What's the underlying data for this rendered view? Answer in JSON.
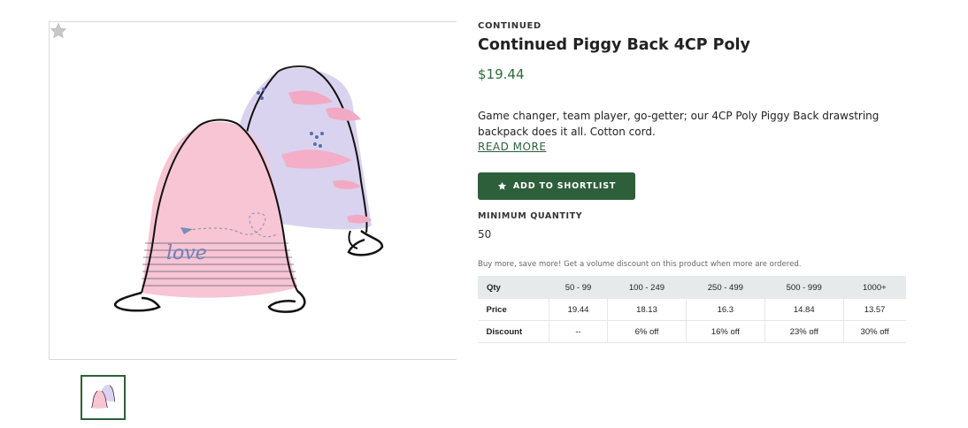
{
  "product": {
    "brand": "CONTINUED",
    "title": "Continued Piggy Back 4CP Poly",
    "price": "$19.44",
    "description": "Game changer, team player, go-getter; our 4CP Poly Piggy Back drawstring backpack does it all. Cotton cord.",
    "read_more_label": "READ MORE",
    "shortlist_label": "ADD TO SHORTLIST",
    "min_qty_label": "MINIMUM QUANTITY",
    "min_qty_value": "50",
    "volume_note": "Buy more, save more! Get a volume discount on this product when more are ordered.",
    "image_text": "love"
  },
  "pricing_table": {
    "headers": [
      "Qty",
      "50 - 99",
      "100 - 249",
      "250 - 499",
      "500 - 999",
      "1000+"
    ],
    "price_row": [
      "Price",
      "19.44",
      "18.13",
      "16.3",
      "14.84",
      "13.57"
    ],
    "discount_row": [
      "Discount",
      "--",
      "6% off",
      "16% off",
      "23% off",
      "30% off"
    ]
  },
  "icons": {
    "favorite": "star-icon",
    "shortlist": "star-icon"
  },
  "colors": {
    "accent": "#2d5f3a",
    "price": "#2d6a3d",
    "table_header_bg": "#e6eaea",
    "bag_front": "#f7c5d3",
    "bag_back": "#d9d3ef"
  }
}
